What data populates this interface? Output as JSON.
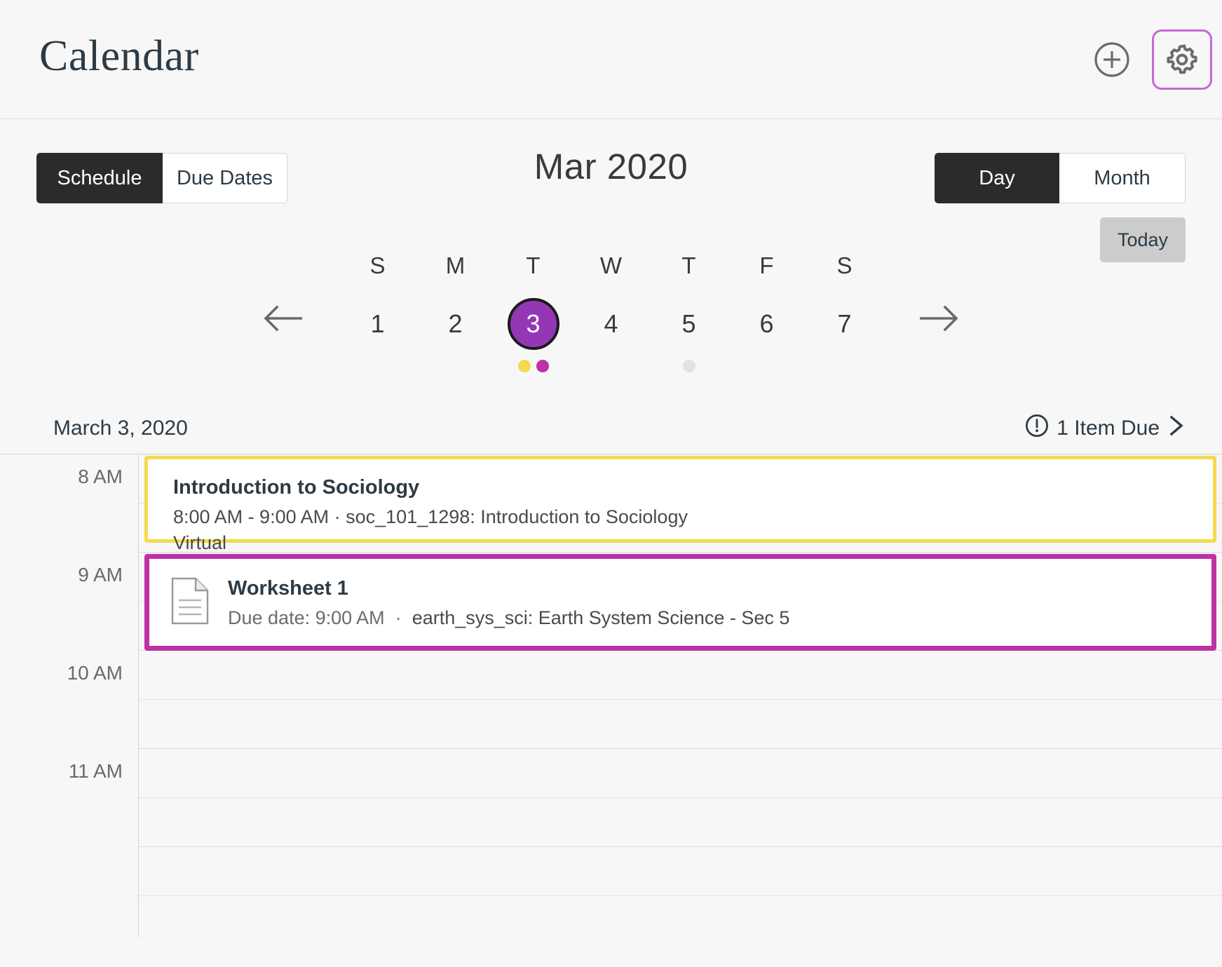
{
  "header": {
    "title": "Calendar",
    "add_icon": "plus-circle-icon",
    "settings_icon": "gear-icon"
  },
  "controls": {
    "view_modes": [
      {
        "label": "Schedule",
        "active": true
      },
      {
        "label": "Due Dates",
        "active": false
      }
    ],
    "month_title": "Mar 2020",
    "ranges": [
      {
        "label": "Day",
        "active": true
      },
      {
        "label": "Month",
        "active": false
      }
    ],
    "today_label": "Today"
  },
  "week": {
    "prev_icon": "arrow-left-icon",
    "next_icon": "arrow-right-icon",
    "days": [
      {
        "dow": "S",
        "num": "1",
        "selected": false,
        "dots": []
      },
      {
        "dow": "M",
        "num": "2",
        "selected": false,
        "dots": []
      },
      {
        "dow": "T",
        "num": "3",
        "selected": true,
        "dots": [
          "#f3db4d",
          "#bf32a4"
        ]
      },
      {
        "dow": "W",
        "num": "4",
        "selected": false,
        "dots": []
      },
      {
        "dow": "T",
        "num": "5",
        "selected": false,
        "dots": [
          "#e2e2e2"
        ]
      },
      {
        "dow": "F",
        "num": "6",
        "selected": false,
        "dots": []
      },
      {
        "dow": "S",
        "num": "7",
        "selected": false,
        "dots": []
      }
    ]
  },
  "day_header": {
    "date_label": "March 3, 2020",
    "items_due_label": "1 Item Due",
    "warning_icon": "exclamation-circle-icon",
    "chevron_icon": "chevron-right-icon"
  },
  "agenda": {
    "hours": [
      "8 AM",
      "9 AM",
      "10 AM",
      "11 AM"
    ],
    "events": [
      {
        "kind": "class",
        "title": "Introduction to Sociology",
        "detail": "8:00 AM - 9:00 AM  ·  soc_101_1298: Introduction to Sociology",
        "location": "Virtual",
        "color": "#f3db4d"
      },
      {
        "kind": "assignment",
        "icon": "document-icon",
        "title": "Worksheet 1",
        "due_prefix": "Due date: 9:00 AM",
        "separator": "·",
        "course": "earth_sys_sci: Earth System Science - Sec 5",
        "color": "#bf32a4"
      }
    ]
  },
  "colors": {
    "accent_purple": "#9437b5",
    "focus_ring": "#c767d8",
    "assignment": "#bf32a4",
    "class_event": "#f3db4d",
    "selected_tab_bg": "#2b2b2b"
  }
}
